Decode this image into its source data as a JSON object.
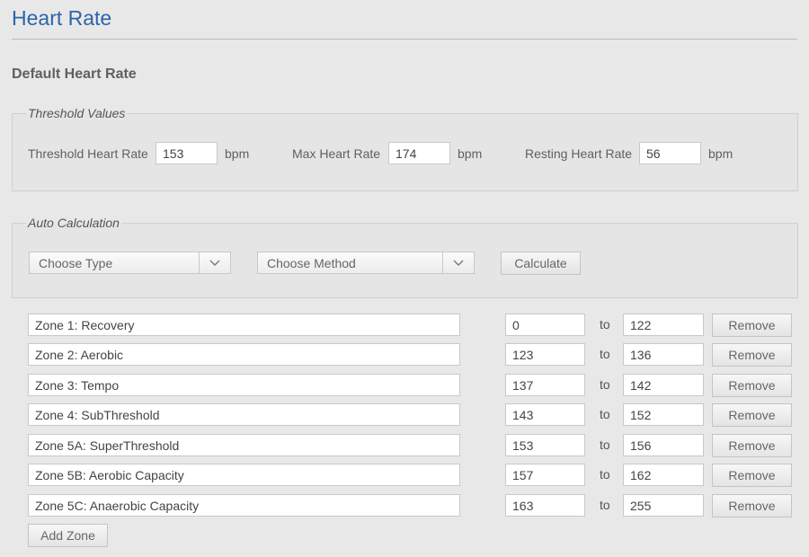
{
  "page": {
    "title": "Heart Rate"
  },
  "section": {
    "heading": "Default Heart Rate"
  },
  "threshold": {
    "legend": "Threshold Values",
    "threshold_label": "Threshold Heart Rate",
    "threshold_value": "153",
    "max_label": "Max Heart Rate",
    "max_value": "174",
    "resting_label": "Resting Heart Rate",
    "resting_value": "56",
    "unit": "bpm"
  },
  "auto": {
    "legend": "Auto Calculation",
    "type_select": "Choose Type",
    "method_select": "Choose Method",
    "calculate_label": "Calculate"
  },
  "zones": [
    {
      "name": "Zone 1: Recovery",
      "from": "0",
      "to": "122"
    },
    {
      "name": "Zone 2: Aerobic",
      "from": "123",
      "to": "136"
    },
    {
      "name": "Zone 3: Tempo",
      "from": "137",
      "to": "142"
    },
    {
      "name": "Zone 4: SubThreshold",
      "from": "143",
      "to": "152"
    },
    {
      "name": "Zone 5A: SuperThreshold",
      "from": "153",
      "to": "156"
    },
    {
      "name": "Zone 5B: Aerobic Capacity",
      "from": "157",
      "to": "162"
    },
    {
      "name": "Zone 5C: Anaerobic Capacity",
      "from": "163",
      "to": "255"
    }
  ],
  "zone_labels": {
    "to": "to",
    "remove": "Remove"
  },
  "add_zone_label": "Add Zone",
  "colors": {
    "title": "#2a65a8",
    "background": "#e9e8e8"
  }
}
